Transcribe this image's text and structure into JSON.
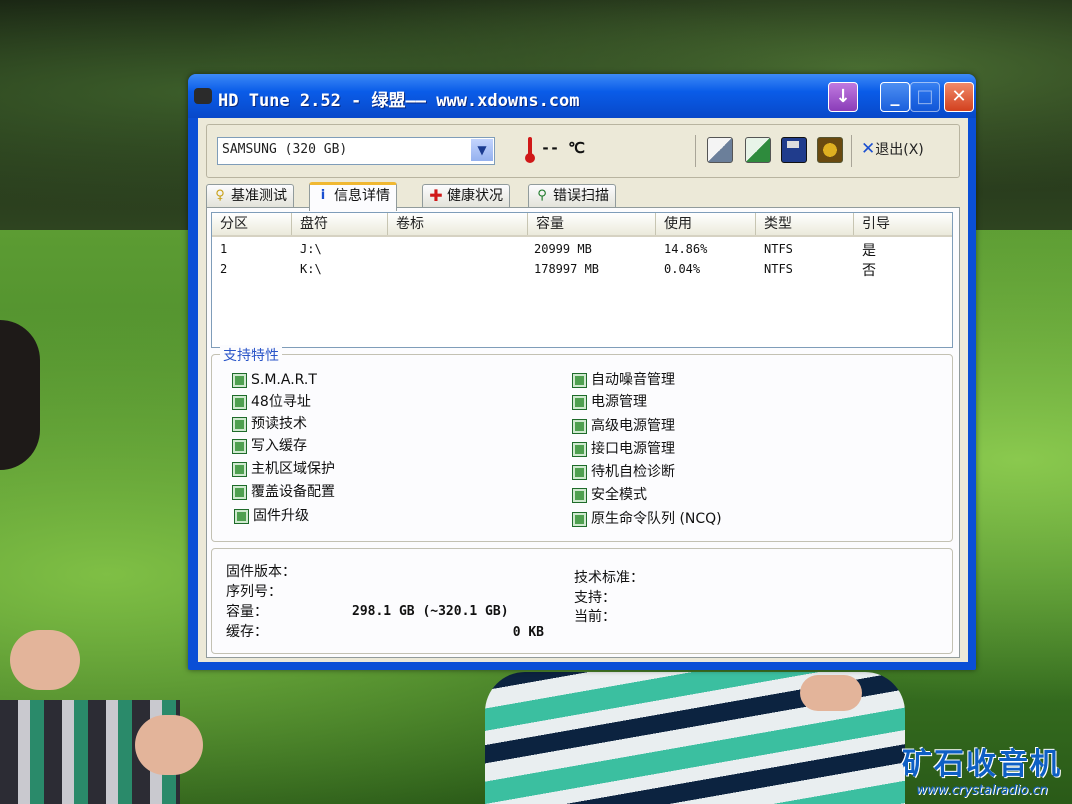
{
  "window": {
    "title": "HD Tune 2.52 - 绿盟—— www.xdowns.com"
  },
  "toolbar": {
    "drive": "SAMSUNG (320 GB)",
    "temperature": "-- ℃",
    "exit_label": "退出(X)"
  },
  "tabs": [
    {
      "label": "基准测试",
      "icon": "benchmark-icon",
      "active": false
    },
    {
      "label": "信息详情",
      "icon": "info-icon",
      "active": true
    },
    {
      "label": "健康状况",
      "icon": "health-icon",
      "active": false
    },
    {
      "label": "错误扫描",
      "icon": "scan-icon",
      "active": false
    }
  ],
  "partitions": {
    "headers": [
      "分区",
      "盘符",
      "卷标",
      "容量",
      "使用",
      "类型",
      "引导"
    ],
    "rows": [
      {
        "part": "1",
        "drive": "J:\\",
        "label": "",
        "capacity": "20999 MB",
        "usage": "14.86%",
        "type": "NTFS",
        "boot": "是"
      },
      {
        "part": "2",
        "drive": "K:\\",
        "label": "",
        "capacity": "178997 MB",
        "usage": "0.04%",
        "type": "NTFS",
        "boot": "否"
      }
    ]
  },
  "features": {
    "title": "支持特性",
    "left": [
      "S.M.A.R.T",
      "48位寻址",
      "预读技术",
      "写入缓存",
      "主机区域保护",
      "覆盖设备配置",
      "固件升级"
    ],
    "right": [
      "自动噪音管理",
      "电源管理",
      "高级电源管理",
      "接口电源管理",
      "待机自检诊断",
      "安全模式",
      "原生命令队列 (NCQ)"
    ]
  },
  "info": {
    "firmware_label": "固件版本：",
    "serial_label": "序列号：",
    "capacity_label": "容量：",
    "capacity_value": "298.1 GB (~320.1 GB)",
    "cache_label": "缓存：",
    "cache_value": "0 KB",
    "standard_label": "技术标准：",
    "supported_label": "支持：",
    "current_label": "当前："
  },
  "watermark": {
    "main": "矿石收音机",
    "sub": "www.crystalradio.cn"
  }
}
